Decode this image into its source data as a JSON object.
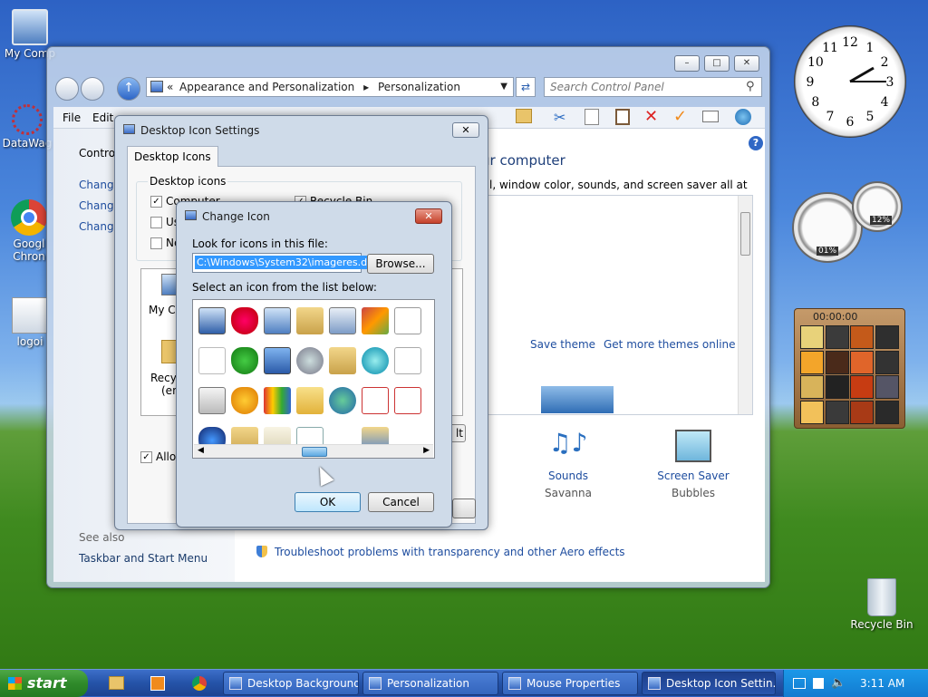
{
  "desktop": {
    "icons": [
      {
        "label": "My Comp",
        "name": "desktop-icon-my-computer"
      },
      {
        "label": "DataWag",
        "name": "desktop-icon-datawag"
      },
      {
        "label": "Googl Chron",
        "name": "desktop-icon-google-chrome"
      },
      {
        "label": "logoi",
        "name": "desktop-icon-logoi"
      },
      {
        "label": "Recycle Bin",
        "name": "desktop-icon-recycle-bin"
      }
    ]
  },
  "control_panel": {
    "breadcrumb_prefix": "«",
    "breadcrumb": [
      "Appearance and Personalization",
      "Personalization"
    ],
    "search_placeholder": "Search Control Panel",
    "menu": [
      "File",
      "Edit"
    ],
    "left_links": [
      "Contro",
      "Change",
      "Change",
      "Change"
    ],
    "see_also_label": "See also",
    "see_also_links": [
      "Taskbar and Start Menu"
    ],
    "heading_partial": "ur computer",
    "description_partial": "l, window color, sounds, and screen saver all at once.",
    "save_theme": "Save theme",
    "more_themes": "Get more themes online",
    "bottom_items": [
      {
        "label": "Sounds",
        "value": "Savanna"
      },
      {
        "label": "Screen Saver",
        "value": "Bubbles"
      }
    ],
    "troubleshoot_link": "Troubleshoot problems with transparency and other Aero effects",
    "help_glyph": "?"
  },
  "desktop_icon_settings": {
    "title": "Desktop Icon Settings",
    "tab": "Desktop Icons",
    "group_label": "Desktop icons",
    "checkboxes": [
      {
        "label": "Computer",
        "checked": true
      },
      {
        "label": "Use",
        "checked": false
      },
      {
        "label": "Ne",
        "checked": false
      },
      {
        "label": "Recycle Bin",
        "checked": true
      }
    ],
    "preview_items": [
      "My Co",
      "Recyc",
      "(emp"
    ],
    "allow_label": "Allow",
    "allow_checked": true,
    "partial_button": "lt"
  },
  "change_icon": {
    "title": "Change Icon",
    "file_label": "Look for icons in this file:",
    "file_value": "C:\\Windows\\System32\\imageres.dll",
    "browse_label": "Browse...",
    "list_label": "Select an icon from the list below:",
    "ok_label": "OK",
    "cancel_label": "Cancel"
  },
  "gadgets": {
    "clock_numbers": [
      "12",
      "1",
      "2",
      "3",
      "4",
      "5",
      "6",
      "7",
      "8",
      "9",
      "10",
      "11"
    ],
    "cpu_value": "01%",
    "mem_value": "12%",
    "puzzle_time": "00:00:00"
  },
  "taskbar": {
    "start_label": "start",
    "items": [
      {
        "label": "Desktop Background",
        "active": false
      },
      {
        "label": "Personalization",
        "active": false
      },
      {
        "label": "Mouse Properties",
        "active": false
      },
      {
        "label": "Desktop Icon Settin...",
        "active": true
      }
    ],
    "clock": "3:11 AM"
  },
  "colors": {
    "link": "#1e4d9f",
    "taskbar": "#2553a8",
    "start_green": "#2f8a2a",
    "close_red": "#c5412a"
  }
}
